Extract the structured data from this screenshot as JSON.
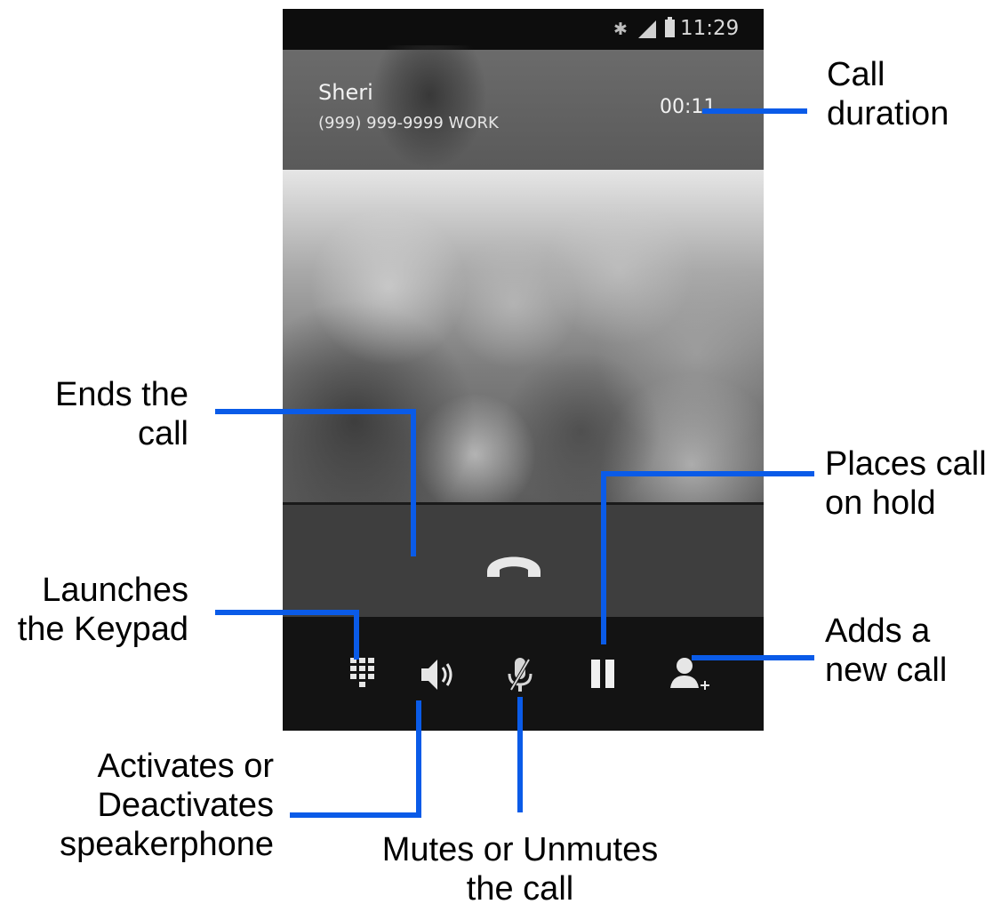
{
  "status_bar": {
    "time": "11:29"
  },
  "call": {
    "contact_name": "Sheri",
    "contact_number": "(999) 999-9999  WORK",
    "duration": "00:11"
  },
  "callouts": {
    "call_duration": {
      "line1": "Call",
      "line2": "duration"
    },
    "end_call": {
      "line1": "Ends the",
      "line2": "call"
    },
    "hold": {
      "line1": "Places call",
      "line2": "on hold"
    },
    "keypad": {
      "line1": "Launches",
      "line2": "the Keypad"
    },
    "add_call": {
      "line1": "Adds a",
      "line2": "new call"
    },
    "speaker": {
      "line1": "Activates or",
      "line2": "Deactivates",
      "line3": "speakerphone"
    },
    "mute": {
      "line1": "Mutes or Unmutes",
      "line2": "the call"
    }
  },
  "colors": {
    "callout_line": "#0a5be8",
    "end_call_icon": "#e8e8e8"
  },
  "icons": [
    "bluetooth-icon",
    "signal-icon",
    "battery-icon",
    "end-call-icon",
    "keypad-icon",
    "speaker-icon",
    "mute-icon",
    "hold-icon",
    "add-call-icon"
  ]
}
